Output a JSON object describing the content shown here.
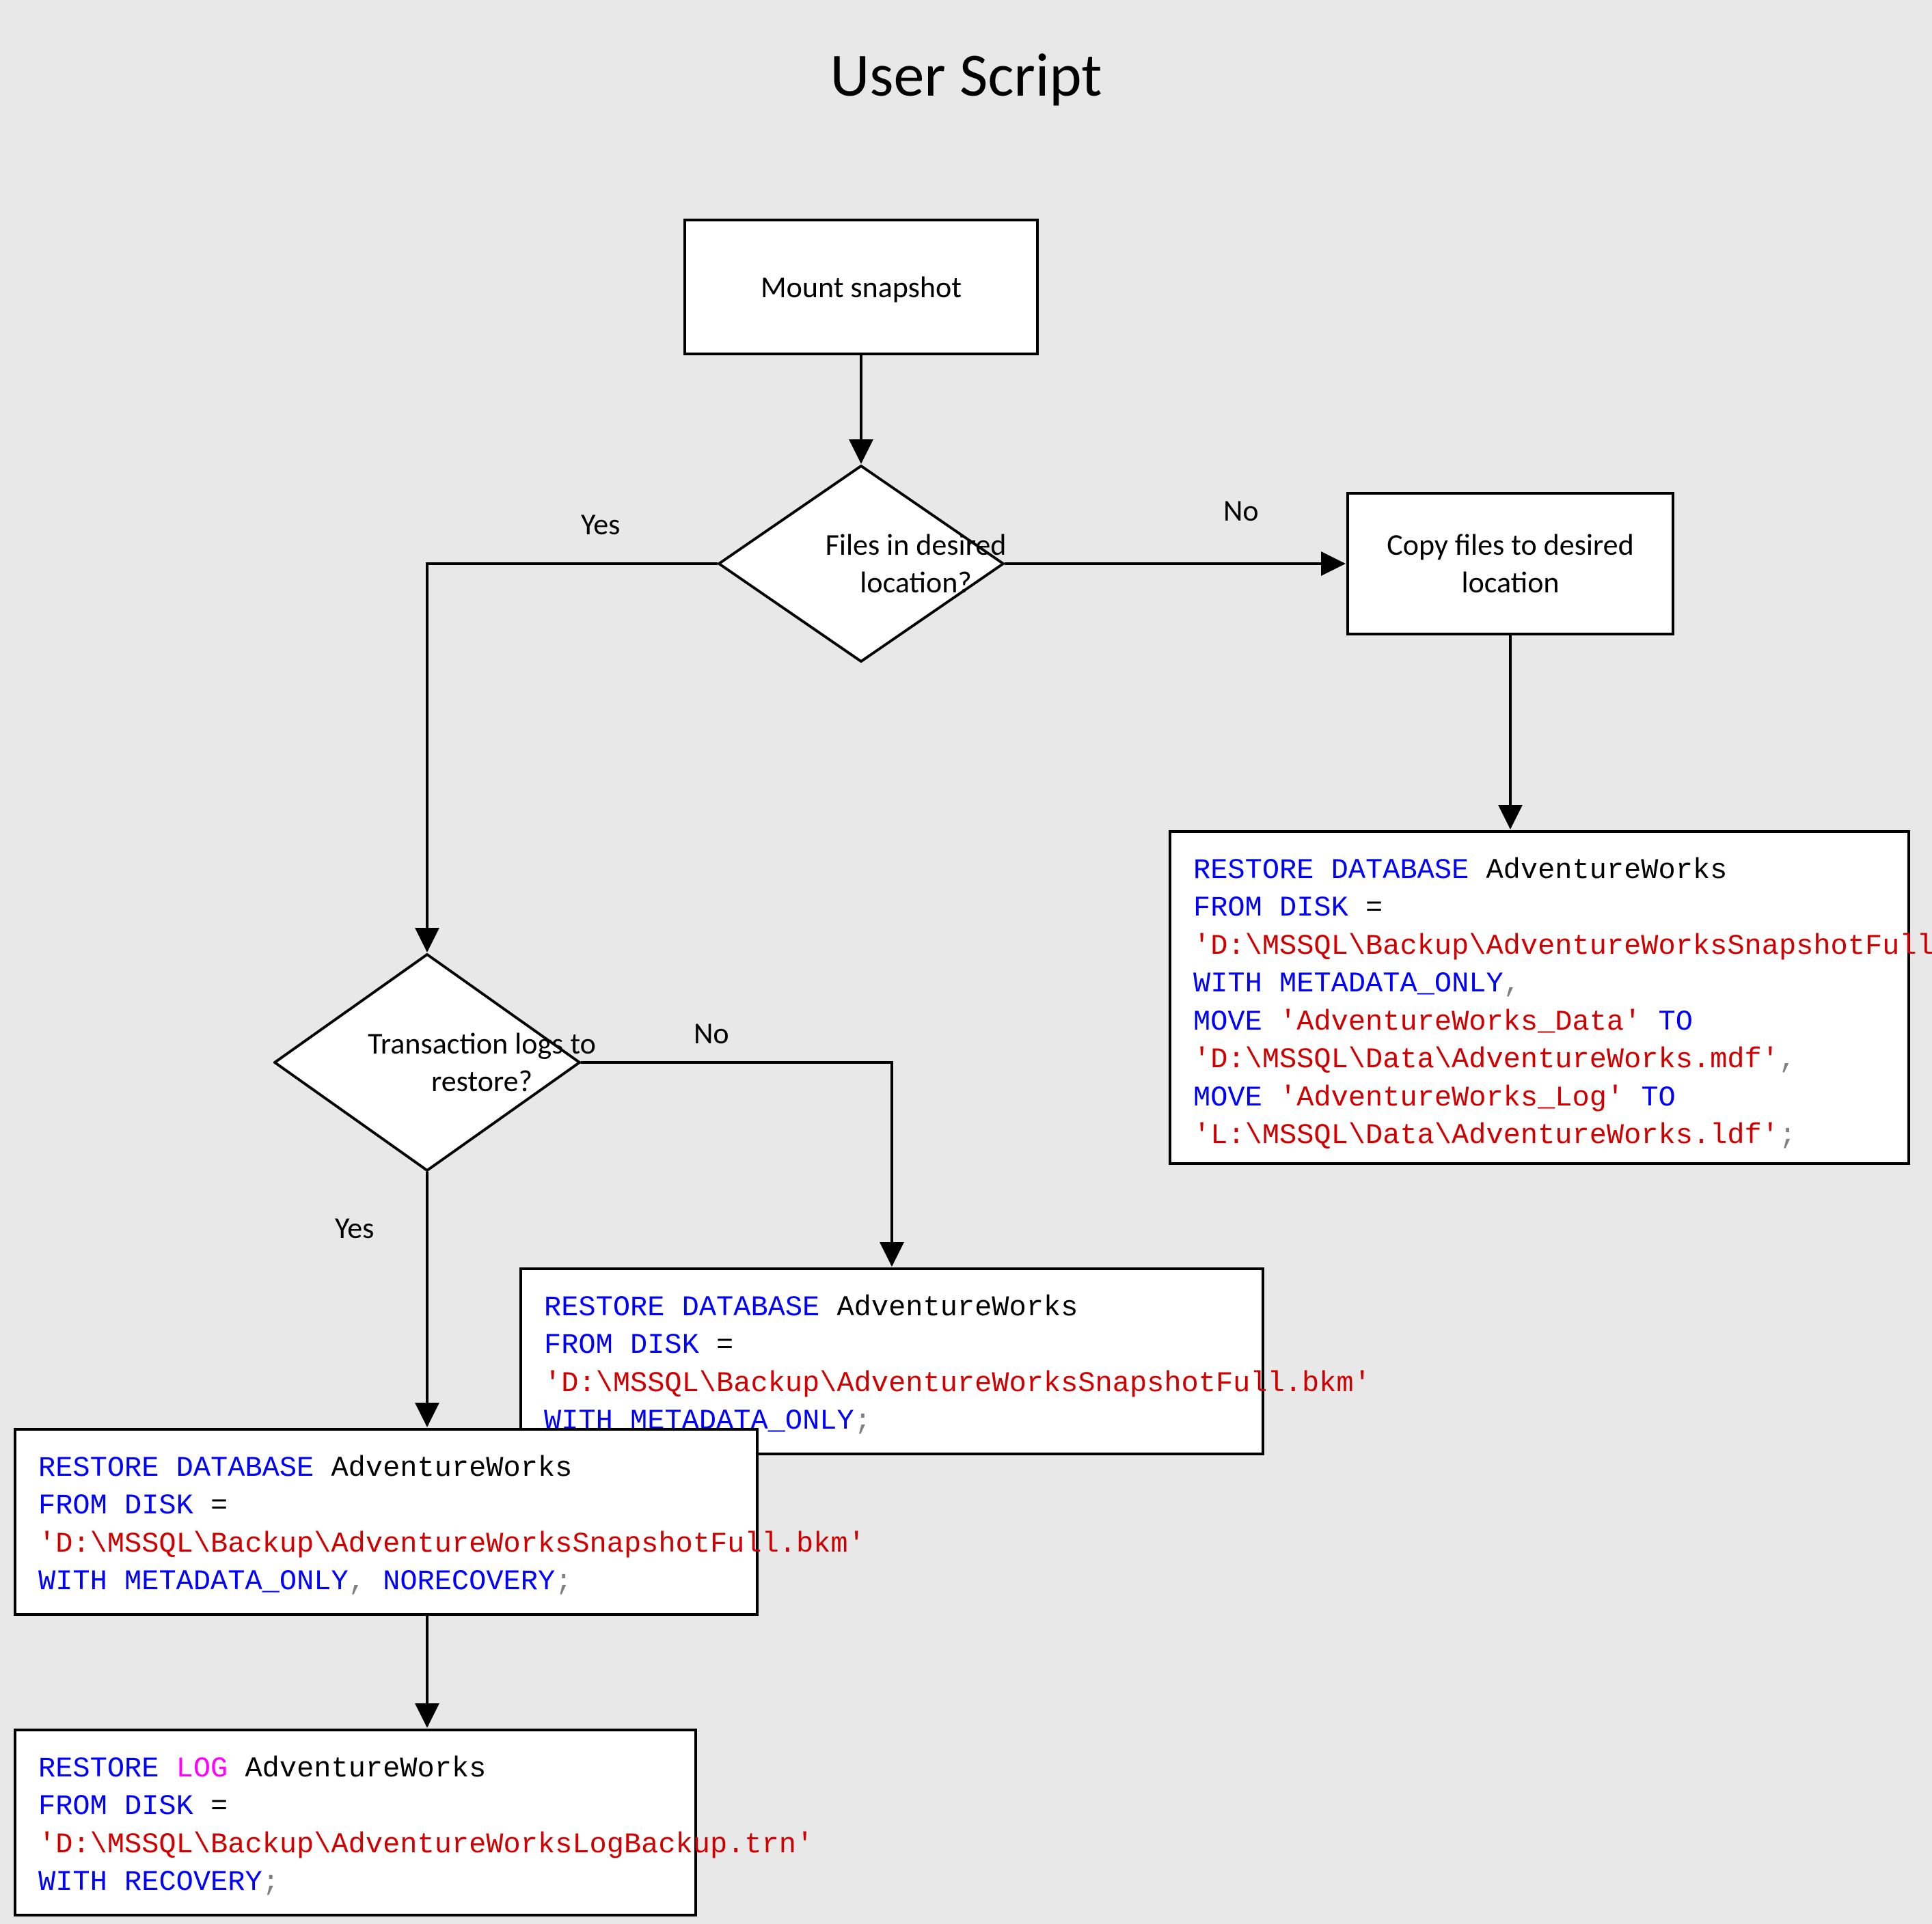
{
  "title": "User Script",
  "nodes": {
    "mount": "Mount snapshot",
    "files_in_location": "Files in desired location?",
    "copy_files": "Copy files to desired location",
    "txn_logs": "Transaction logs to restore?"
  },
  "labels": {
    "yes1": "Yes",
    "no1": "No",
    "yes2": "Yes",
    "no2": "No"
  },
  "code": {
    "restore_move": {
      "l1_kw": "RESTORE DATABASE",
      "l1_pl": " AdventureWorks",
      "l2_kw": "FROM DISK",
      "l2_pl": " =",
      "l3_str": "'D:\\MSSQL\\Backup\\AdventureWorksSnapshotFull.bkm'",
      "l4_kw1": "WITH",
      "l4_kw2": " METADATA_ONLY",
      "l4_gray": ",",
      "l5_kw1": "MOVE",
      "l5_str": " 'AdventureWorks_Data'",
      "l5_kw2": " TO",
      "l6_str": "'D:\\MSSQL\\Data\\AdventureWorks.mdf'",
      "l6_gray": ",",
      "l7_kw1": "MOVE",
      "l7_str": " 'AdventureWorks_Log'",
      "l7_kw2": " TO",
      "l8_str": "'L:\\MSSQL\\Data\\AdventureWorks.ldf'",
      "l8_gray": ";"
    },
    "restore_meta": {
      "l1_kw": "RESTORE DATABASE",
      "l1_pl": " AdventureWorks",
      "l2_kw": "FROM DISK",
      "l2_pl": " =",
      "l3_str": "'D:\\MSSQL\\Backup\\AdventureWorksSnapshotFull.bkm'",
      "l4_kw1": "WITH",
      "l4_kw2": " METADATA_ONLY",
      "l4_gray": ";"
    },
    "restore_norec": {
      "l1_kw": "RESTORE DATABASE",
      "l1_pl": " AdventureWorks",
      "l2_kw": "FROM DISK",
      "l2_pl": " =",
      "l3_str": "'D:\\MSSQL\\Backup\\AdventureWorksSnapshotFull.bkm'",
      "l4_kw1": "WITH",
      "l4_kw2": " METADATA_ONLY",
      "l4_gray1": ",",
      "l4_kw3": " NORECOVERY",
      "l4_gray2": ";"
    },
    "restore_log": {
      "l1_kw1": "RESTORE",
      "l1_mag": " LOG",
      "l1_pl": " AdventureWorks",
      "l2_kw": "FROM DISK",
      "l2_pl": " =",
      "l3_str": "'D:\\MSSQL\\Backup\\AdventureWorksLogBackup.trn'",
      "l4_kw1": "WITH",
      "l4_kw2": " RECOVERY",
      "l4_gray": ";"
    }
  }
}
